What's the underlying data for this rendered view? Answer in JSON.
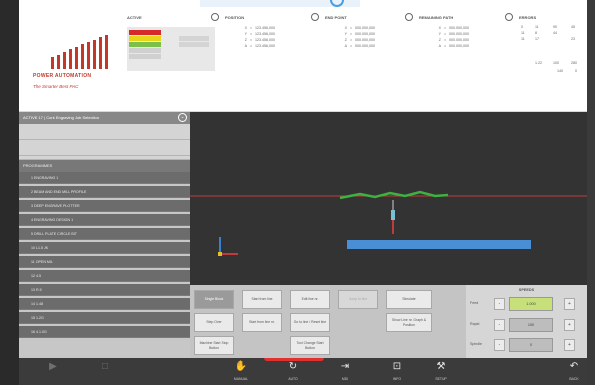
{
  "colors": {
    "brand_red": "#c0392b",
    "active_red": "#d62a2a",
    "active_yellow": "#e5d61a",
    "active_green": "#7cc04a",
    "viewport_bg": "#333333",
    "x_axis_red": "#c23b3b",
    "rail_blue": "#4a8fd6",
    "toolpath_green": "#3fb13f",
    "speed_highlight": "#c8e07a"
  },
  "brand": {
    "name": "POWER AUTOMATION",
    "tagline": "The Smarter Best PAC"
  },
  "header": {
    "active": {
      "title": "ACTIVE",
      "rows": [
        "G0 G90",
        "F5 S0",
        "G54 G17",
        "T1 D1",
        "M3 M8"
      ]
    },
    "position": {
      "title": "POSITION",
      "rows": [
        {
          "axis": "X",
          "value": "123.456,000"
        },
        {
          "axis": "Y",
          "value": "123.456,000"
        },
        {
          "axis": "Z",
          "value": "123.456,000"
        },
        {
          "axis": "A",
          "value": "123.456,000"
        }
      ]
    },
    "end_point": {
      "title": "END POINT",
      "rows": [
        {
          "axis": "X",
          "value": "000.000,000"
        },
        {
          "axis": "Y",
          "value": "000.000,000"
        },
        {
          "axis": "Z",
          "value": "000.000,000"
        },
        {
          "axis": "A",
          "value": "000.000,000"
        }
      ]
    },
    "remaining_path": {
      "title": "REMAINING PATH",
      "rows": [
        {
          "axis": "X",
          "value": "000.000,000"
        },
        {
          "axis": "Y",
          "value": "000.000,000"
        },
        {
          "axis": "Z",
          "value": "000.000,000"
        },
        {
          "axis": "A",
          "value": "000.000,000"
        }
      ]
    },
    "errors": {
      "title": "ERRORS",
      "cells": [
        "0",
        "11",
        "90",
        "45",
        "11",
        "8",
        "44",
        "",
        "11",
        "17",
        "",
        "23",
        "",
        "1.22",
        "100",
        "280",
        "",
        "",
        "140",
        "0"
      ]
    }
  },
  "sidebar": {
    "header": "ACTIVE  17 | Cork Engraving Job Selection",
    "chevron": "⌄",
    "section_title": "PROGRAMMES",
    "items": [
      "1  ENGRAVING 1",
      "2  BEAM AND END MILL PROFILE",
      "3  DEEP ENGRAVE PLOTTER",
      "4  ENGRAVING DESIGN 1",
      "5  DRILL PLATE CIRCLE BIT",
      "10  L1.5 JK",
      "11  OPEN MIL",
      "12  4.5",
      "13  R.5",
      "14  1.48",
      "15  1.2G",
      "16  4.1.0G"
    ]
  },
  "controls": {
    "row1": [
      "Single Block",
      "Start from line",
      "Edit line nr.",
      "Jump to line",
      "Simulate"
    ],
    "row2": [
      "Step Over",
      "Start from line nr.",
      "Go to line / Reset line",
      "Show Line nr. Graph & Position"
    ],
    "row3": [
      "Machine Start Stop Button",
      "Tool Change Start Button"
    ],
    "speed": {
      "title": "SPEEDS",
      "rows": [
        {
          "label": "Feed",
          "minus": "-",
          "value": "1.000",
          "plus": "+"
        },
        {
          "label": "Rapid",
          "minus": "-",
          "value": "100",
          "plus": "+"
        },
        {
          "label": "Spindle",
          "minus": "-",
          "value": "0",
          "plus": "+"
        }
      ]
    }
  },
  "toolbar": {
    "left": [
      {
        "icon": "▶",
        "label": ""
      },
      {
        "icon": "□",
        "label": ""
      }
    ],
    "center": [
      {
        "icon": "✋",
        "label": "MANUAL"
      },
      {
        "icon": "↻",
        "label": "AUTO"
      },
      {
        "icon": "⇥",
        "label": "MDI"
      },
      {
        "icon": "⊡",
        "label": "INFO"
      },
      {
        "icon": "⚒",
        "label": "SETUP"
      }
    ],
    "right": {
      "icon": "↶",
      "label": "BACK"
    }
  }
}
